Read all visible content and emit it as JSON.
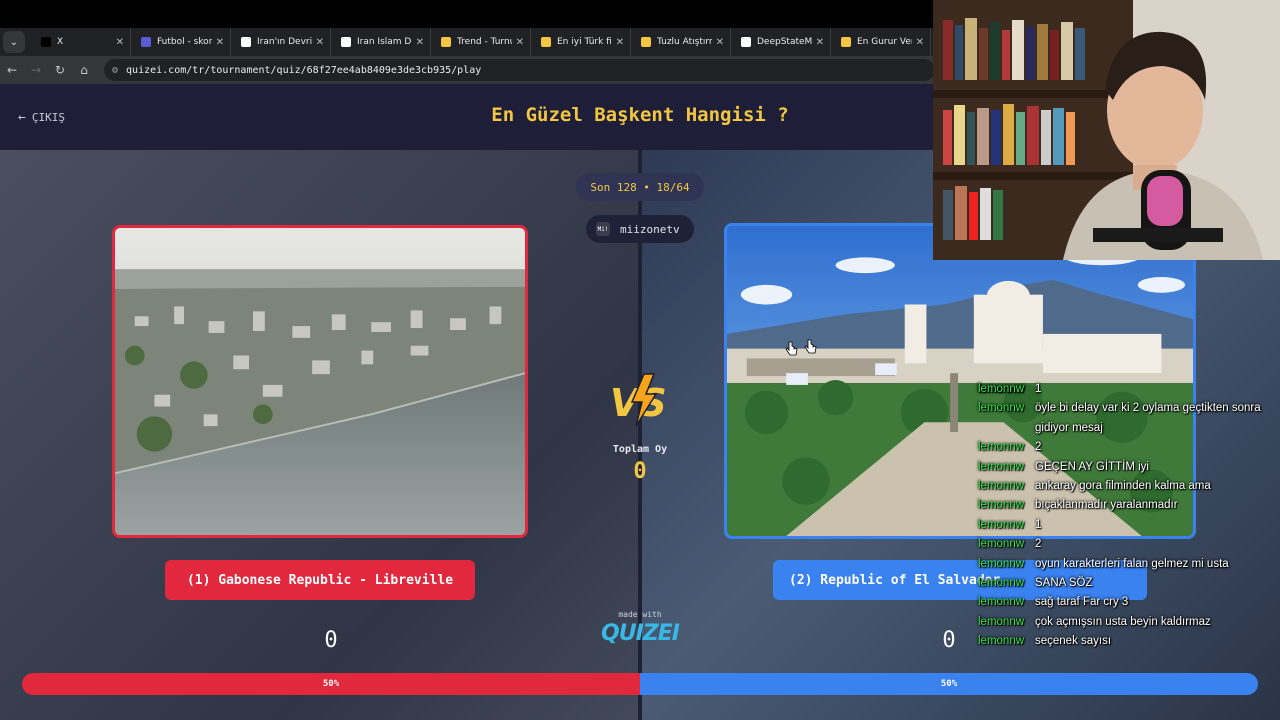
{
  "browser": {
    "tabs": [
      {
        "label": "X",
        "favicon_color": "#000000"
      },
      {
        "label": "Futbol - skorla",
        "favicon_color": "#5b5bd6"
      },
      {
        "label": "İran'ın Devrimi",
        "favicon_color": "#ffffff"
      },
      {
        "label": "İran İslam Dev",
        "favicon_color": "#ffffff"
      },
      {
        "label": "Trend - Turnuv",
        "favicon_color": "#f3c641"
      },
      {
        "label": "En iyi Türk film",
        "favicon_color": "#f3c641"
      },
      {
        "label": "Tuzlu Atıştırma",
        "favicon_color": "#f3c641"
      },
      {
        "label": "DeepStateMAP",
        "favicon_color": "#ffffff"
      },
      {
        "label": "En Gurur Verici",
        "favicon_color": "#f3c641"
      }
    ],
    "url": "quizei.com/tr/tournament/quiz/68f27ee4ab8409e3de3cb935/play"
  },
  "header": {
    "exit_label": "ÇIKIŞ",
    "title": "En Güzel Başkent Hangisi ?"
  },
  "round": {
    "label": "Son 128 • 18/64"
  },
  "user": {
    "avatar_text": "Mi!",
    "name": "miizonetv"
  },
  "vs": {
    "total_label": "Toplam Oy",
    "total_value": "0"
  },
  "choices": {
    "left": {
      "label": "(1) Gabonese Republic - Libreville",
      "score": "0",
      "percent_label": "50%",
      "percent": 50
    },
    "right": {
      "label": "(2) Republic of El Salvador",
      "score": "0",
      "percent_label": "50%",
      "percent": 50
    }
  },
  "branding": {
    "made_with": "made with",
    "logo": "QUIZEI"
  },
  "chat": [
    {
      "nick": "lemonnw",
      "text": ""
    },
    {
      "nick": "lemonnw",
      "text": "1"
    },
    {
      "nick": "lemonnw",
      "text": "öyle bi delay var ki 2 oylama geçtikten sonra gidiyor mesaj"
    },
    {
      "nick": "lemonnw",
      "text": "2"
    },
    {
      "nick": "lemonnw",
      "text": "GEÇEN AY GİTTİM iyi"
    },
    {
      "nick": "lemonnw",
      "text": "ankaray gora filminden kalma ama"
    },
    {
      "nick": "lemonnw",
      "text": "bıçaklanmadır yaralanmadır"
    },
    {
      "nick": "lemonnw",
      "text": "1"
    },
    {
      "nick": "lemonnw",
      "text": "2"
    },
    {
      "nick": "lemonnw",
      "text": "oyun karakterleri falan gelmez mi usta"
    },
    {
      "nick": "lemonnw",
      "text": "SANA SÖZ"
    },
    {
      "nick": "lemonnw",
      "text": "sağ taraf Far cry 3"
    },
    {
      "nick": "lemonnw",
      "text": "çok açmışsın usta beyin kaldırmaz"
    },
    {
      "nick": "lemonnw",
      "text": "seçenek sayısı"
    }
  ],
  "colors": {
    "left_accent": "#e1283d",
    "right_accent": "#3a82f0",
    "title_gold": "#f3c641",
    "chat_nick": "#35e24a"
  }
}
